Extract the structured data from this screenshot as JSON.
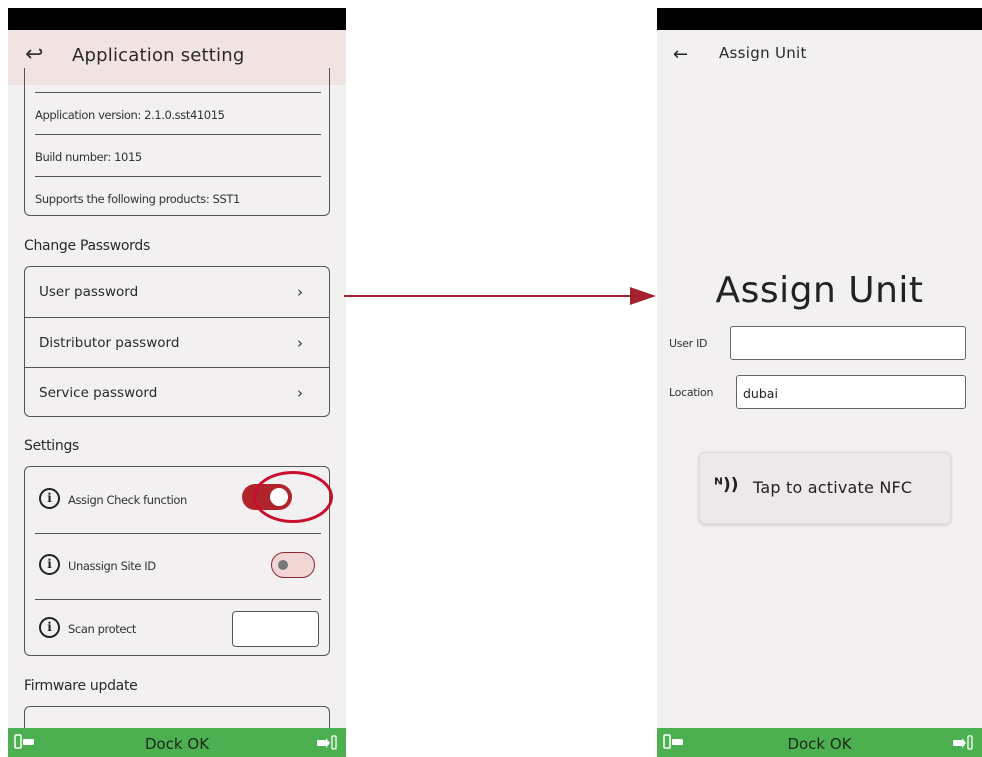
{
  "left_screen": {
    "header": {
      "title": "Application setting"
    },
    "info": {
      "app_version": "Application version: 2.1.0.sst41015",
      "build_number": "Build number: 1015",
      "supported_products": "Supports the following products: SST1"
    },
    "change_passwords": {
      "title": "Change Passwords",
      "items": [
        {
          "label": "User password"
        },
        {
          "label": "Distributor password"
        },
        {
          "label": "Service password"
        }
      ]
    },
    "settings": {
      "title": "Settings",
      "items": [
        {
          "label": "Assign Check function",
          "enabled": true
        },
        {
          "label": "Unassign Site ID",
          "enabled": false
        },
        {
          "label": "Scan protect",
          "value": ""
        }
      ]
    },
    "firmware": {
      "title": "Firmware update"
    },
    "dock": {
      "status": "Dock OK"
    }
  },
  "right_screen": {
    "header": {
      "title": "Assign Unit"
    },
    "heading": "Assign Unit",
    "fields": {
      "user_id": {
        "label": "User ID",
        "value": ""
      },
      "location": {
        "label": "Location",
        "value": "dubai"
      }
    },
    "nfc_button": {
      "label": "Tap to activate NFC"
    },
    "dock": {
      "status": "Dock OK"
    }
  },
  "colors": {
    "accent_red": "#b0242c",
    "highlight_ring": "#c8102e",
    "header_bg": "#f1e3e2",
    "dock_green": "#4caf50",
    "arrow": "#a3222d"
  }
}
